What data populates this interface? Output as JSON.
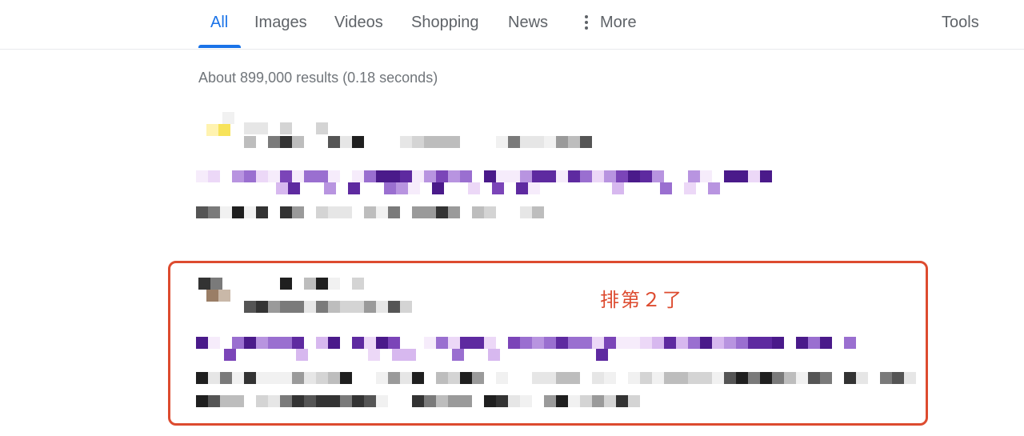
{
  "nav": {
    "tabs": [
      {
        "label": "All",
        "active": true
      },
      {
        "label": "Images"
      },
      {
        "label": "Videos"
      },
      {
        "label": "Shopping"
      },
      {
        "label": "News"
      },
      {
        "label": "More"
      }
    ],
    "tools_label": "Tools"
  },
  "result_stats": "About 899,000 results (0.18 seconds)",
  "annotation": {
    "text": "排第２了",
    "color": "#dd4b2f"
  },
  "colors": {
    "accent": "#1a73e8",
    "muted_text": "#70757a",
    "link_visited": "#5b2a9a",
    "highlight_border": "#dd4b2f"
  },
  "icons": {
    "more": "three-dots-vertical-icon"
  }
}
